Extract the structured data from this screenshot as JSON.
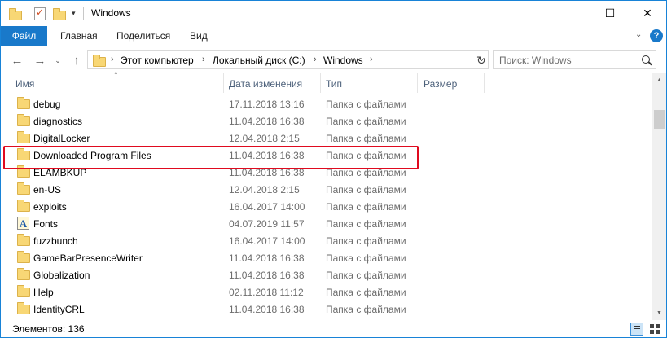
{
  "window": {
    "title": "Windows",
    "minimize": "—",
    "maximize": "☐",
    "close": "✕"
  },
  "quick_access": {
    "dropdown": "▾"
  },
  "ribbon": {
    "tabs": [
      "Файл",
      "Главная",
      "Поделиться",
      "Вид"
    ],
    "expand": "⌄",
    "help": "?"
  },
  "nav": {
    "back": "←",
    "forward": "→",
    "recent": "⌄",
    "up": "↑",
    "breadcrumbs": [
      "Этот компьютер",
      "Локальный диск (C:)",
      "Windows"
    ],
    "separator": "›",
    "address_dropdown": "⌄",
    "refresh": "↻",
    "search_placeholder": "Поиск: Windows"
  },
  "columns": {
    "name": "Имя",
    "date": "Дата изменения",
    "type": "Тип",
    "size": "Размер"
  },
  "files": [
    {
      "name": "debug",
      "date": "17.11.2018 13:16",
      "type": "Папка с файлами",
      "icon": "folder-icon"
    },
    {
      "name": "diagnostics",
      "date": "11.04.2018 16:38",
      "type": "Папка с файлами",
      "icon": "folder-icon"
    },
    {
      "name": "DigitalLocker",
      "date": "12.04.2018 2:15",
      "type": "Папка с файлами",
      "icon": "folder-icon"
    },
    {
      "name": "Downloaded Program Files",
      "date": "11.04.2018 16:38",
      "type": "Папка с файлами",
      "icon": "folder-icon"
    },
    {
      "name": "ELAMBKUP",
      "date": "11.04.2018 16:38",
      "type": "Папка с файлами",
      "icon": "folder-icon"
    },
    {
      "name": "en-US",
      "date": "12.04.2018 2:15",
      "type": "Папка с файлами",
      "icon": "folder-icon"
    },
    {
      "name": "exploits",
      "date": "16.04.2017 14:00",
      "type": "Папка с файлами",
      "icon": "folder-icon"
    },
    {
      "name": "Fonts",
      "date": "04.07.2019 11:57",
      "type": "Папка с файлами",
      "icon": "fonts-folder-icon",
      "icon_glyph": "A"
    },
    {
      "name": "fuzzbunch",
      "date": "16.04.2017 14:00",
      "type": "Папка с файлами",
      "icon": "folder-icon"
    },
    {
      "name": "GameBarPresenceWriter",
      "date": "11.04.2018 16:38",
      "type": "Папка с файлами",
      "icon": "folder-icon"
    },
    {
      "name": "Globalization",
      "date": "11.04.2018 16:38",
      "type": "Папка с файлами",
      "icon": "folder-icon"
    },
    {
      "name": "Help",
      "date": "02.11.2018 11:12",
      "type": "Папка с файлами",
      "icon": "folder-icon"
    },
    {
      "name": "IdentityCRL",
      "date": "11.04.2018 16:38",
      "type": "Папка с файлами",
      "icon": "folder-icon"
    }
  ],
  "highlighted_item": "Downloaded Program Files",
  "status": {
    "items_count": "Элементов: 136"
  },
  "colors": {
    "accent": "#1979ca",
    "highlight_border": "#e00a1f",
    "folder": "#f8d775",
    "secondary_text": "#6d6d6d",
    "header_text": "#4c607a"
  }
}
